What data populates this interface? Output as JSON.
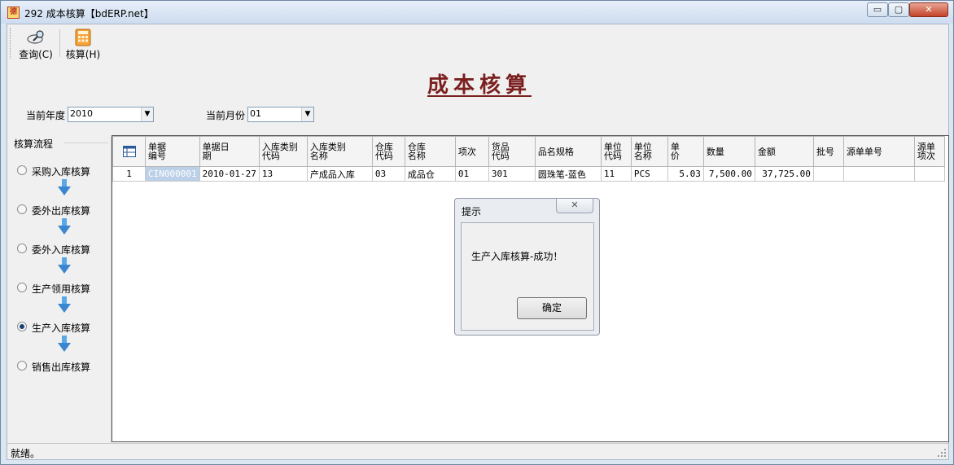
{
  "window": {
    "title": "292 成本核算【bdERP.net】",
    "icon_char": "德",
    "min_label": "▭",
    "max_label": "▢",
    "close_label": "✕"
  },
  "toolbar": {
    "query_label": "查询(C)",
    "calc_label": "核算(H)"
  },
  "form": {
    "title": "成本核算",
    "year_label": "当前年度",
    "year_value": "2010",
    "month_label": "当前月份",
    "month_value": "01"
  },
  "flow": {
    "title": "核算流程",
    "items": [
      {
        "label": "采购入库核算",
        "checked": false
      },
      {
        "label": "委外出库核算",
        "checked": false
      },
      {
        "label": "委外入库核算",
        "checked": false
      },
      {
        "label": "生产领用核算",
        "checked": false
      },
      {
        "label": "生产入库核算",
        "checked": true
      },
      {
        "label": "销售出库核算",
        "checked": false
      }
    ]
  },
  "grid": {
    "columns": [
      "单据\n编号",
      "单据日\n期",
      "入库类别\n代码",
      "入库类别\n名称",
      "仓库\n代码",
      "仓库\n名称",
      "项次",
      "货品\n代码",
      "品名规格",
      "单位\n代码",
      "单位\n名称",
      "单\n价",
      "数量",
      "金额",
      "批号",
      "源单单号",
      "源单\n项次"
    ],
    "rows": [
      {
        "row_num": "1",
        "cells": [
          "CIN000001",
          "2010-01-27",
          "13",
          "产成品入库",
          "03",
          "成品仓",
          "01",
          "301",
          "圆珠笔-蓝色",
          "11",
          "PCS",
          "5.03",
          "7,500.00",
          "37,725.00",
          "",
          "",
          ""
        ]
      }
    ]
  },
  "dialog": {
    "title": "提示",
    "close_label": "✕",
    "message": "生产入库核算-成功！",
    "ok_label": "确定"
  },
  "status": {
    "text": "就绪。"
  }
}
